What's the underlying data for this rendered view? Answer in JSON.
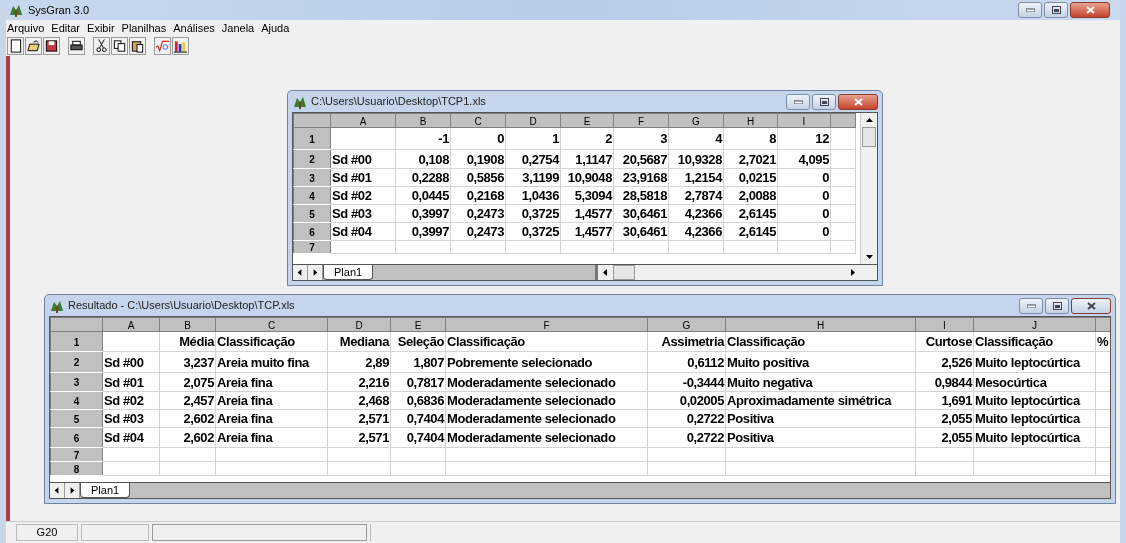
{
  "window": {
    "title": "SysGran 3.0"
  },
  "menu": [
    "Arquivo",
    "Editar",
    "Exibir",
    "Planilhas",
    "Análises",
    "Janela",
    "Ajuda"
  ],
  "documents": [
    {
      "title": "C:\\Users\\Usuario\\Desktop\\TCP1.xls",
      "columns": [
        {
          "label": "A",
          "kind": "text"
        },
        {
          "label": "B",
          "kind": "number"
        },
        {
          "label": "C",
          "kind": "number"
        },
        {
          "label": "D",
          "kind": "number"
        },
        {
          "label": "E",
          "kind": "number"
        },
        {
          "label": "F",
          "kind": "number"
        },
        {
          "label": "G",
          "kind": "number"
        },
        {
          "label": "H",
          "kind": "number"
        },
        {
          "label": "I",
          "kind": "number"
        },
        {
          "kind": "number"
        }
      ],
      "rows": [
        {
          "number": "1",
          "cells": [
            null,
            "-1",
            "0",
            "1",
            "2",
            "3",
            "4",
            "8",
            "12"
          ]
        },
        {
          "number": "2",
          "cells": [
            "Sd #00",
            "0,108",
            "0,1908",
            "0,2754",
            "1,1147",
            "20,5687",
            "10,9328",
            "2,7021",
            "4,095"
          ]
        },
        {
          "number": "3",
          "cells": [
            "Sd #01",
            "0,2288",
            "0,5856",
            "3,1199",
            "10,9048",
            "23,9168",
            "1,2154",
            "0,0215",
            "0"
          ]
        },
        {
          "number": "4",
          "cells": [
            "Sd #02",
            "0,0445",
            "0,2168",
            "1,0436",
            "5,3094",
            "28,5818",
            "2,7874",
            "2,0088",
            "0"
          ]
        },
        {
          "number": "5",
          "cells": [
            "Sd #03",
            "0,3997",
            "0,2473",
            "0,3725",
            "1,4577",
            "30,6461",
            "4,2366",
            "2,6145",
            "0"
          ]
        },
        {
          "number": "6",
          "cells": [
            "Sd #04",
            "0,3997",
            "0,2473",
            "0,3725",
            "1,4577",
            "30,6461",
            "4,2366",
            "2,6145",
            "0"
          ]
        },
        {
          "number": "7"
        }
      ],
      "sheet_tabs": [
        {
          "label": "Plan1",
          "selected": true
        }
      ]
    },
    {
      "title": "Resultado - C:\\Users\\Usuario\\Desktop\\TCP.xls",
      "columns": [
        {
          "label": "A",
          "kind": "text"
        },
        {
          "label": "B",
          "kind": "number"
        },
        {
          "label": "C",
          "kind": "text"
        },
        {
          "label": "D",
          "kind": "number"
        },
        {
          "label": "E",
          "kind": "number"
        },
        {
          "label": "F",
          "kind": "text"
        },
        {
          "label": "G",
          "kind": "number"
        },
        {
          "label": "H",
          "kind": "text"
        },
        {
          "label": "I",
          "kind": "number"
        },
        {
          "label": "J",
          "kind": "text"
        },
        {
          "kind": "text"
        }
      ],
      "rows": [
        {
          "number": "1",
          "cells": [
            null,
            "Média",
            "Classificação",
            "Mediana",
            "Seleção",
            "Classificação",
            "Assimetria",
            "Classificação",
            "Curtose",
            "Classificação",
            "%"
          ]
        },
        {
          "number": "2",
          "cells": [
            "Sd #00",
            "3,237",
            "Areia muito fina",
            "2,89",
            "1,807",
            "Pobremente selecionado",
            "0,6112",
            "Muito positiva",
            "2,526",
            "Muito leptocúrtica"
          ]
        },
        {
          "number": "3",
          "cells": [
            "Sd #01",
            "2,075",
            "Areia fina",
            "2,216",
            "0,7817",
            "Moderadamente selecionado",
            "-0,3444",
            "Muito negativa",
            "0,9844",
            "Mesocúrtica"
          ]
        },
        {
          "number": "4",
          "cells": [
            "Sd #02",
            "2,457",
            "Areia fina",
            "2,468",
            "0,6836",
            "Moderadamente selecionado",
            "0,02005",
            "Aproximadamente simétrica",
            "1,691",
            "Muito leptocúrtica"
          ]
        },
        {
          "number": "5",
          "cells": [
            "Sd #03",
            "2,602",
            "Areia fina",
            "2,571",
            "0,7404",
            "Moderadamente selecionado",
            "0,2722",
            "Positiva",
            "2,055",
            "Muito leptocúrtica"
          ]
        },
        {
          "number": "6",
          "cells": [
            "Sd #04",
            "2,602",
            "Areia fina",
            "2,571",
            "0,7404",
            "Moderadamente selecionado",
            "0,2722",
            "Positiva",
            "2,055",
            "Muito leptocúrtica"
          ]
        },
        {
          "number": "7"
        },
        {
          "number": "8"
        }
      ],
      "sheet_tabs": [
        {
          "label": "Plan1",
          "selected": true
        }
      ]
    }
  ],
  "status_bar": [
    "G20"
  ]
}
